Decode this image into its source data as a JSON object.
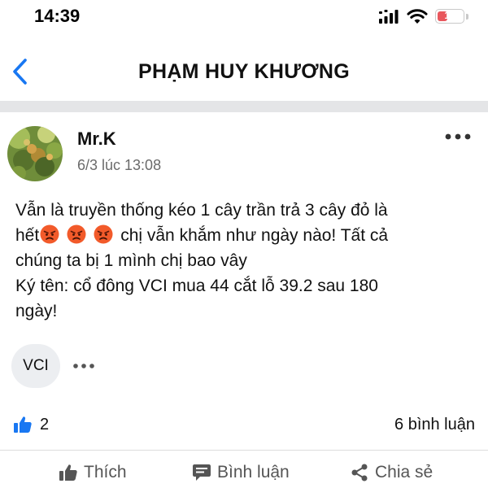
{
  "status_bar": {
    "time": "14:39",
    "battery": "14"
  },
  "nav": {
    "title": "PHẠM HUY KHƯƠNG"
  },
  "post": {
    "author": "Mr.K",
    "time": "6/3 lúc 13:08",
    "lines": [
      "Vẫn là truyền thống kéo 1 cây trần trả 3 cây đỏ là",
      "chị vẫn khắm như ngày nào! Tất cả",
      "chúng ta bị 1 mình chị bao vây",
      "Ký tên: cổ đông VCI mua 44 cắt lỗ 39.2 sau 180",
      "ngày!"
    ],
    "line2_prefix": "hết",
    "emojis": [
      "angry-face",
      "angry-face",
      "angry-face"
    ],
    "tag": "VCI",
    "like_count": "2",
    "comment_count": "6 bình luận"
  },
  "actions": {
    "like": "Thích",
    "comment": "Bình luận",
    "share": "Chia sẻ"
  },
  "colors": {
    "accent": "#1877f2",
    "divider": "#e4e5e7",
    "battery": "#e9575d",
    "emoji": "#f25a2a"
  }
}
